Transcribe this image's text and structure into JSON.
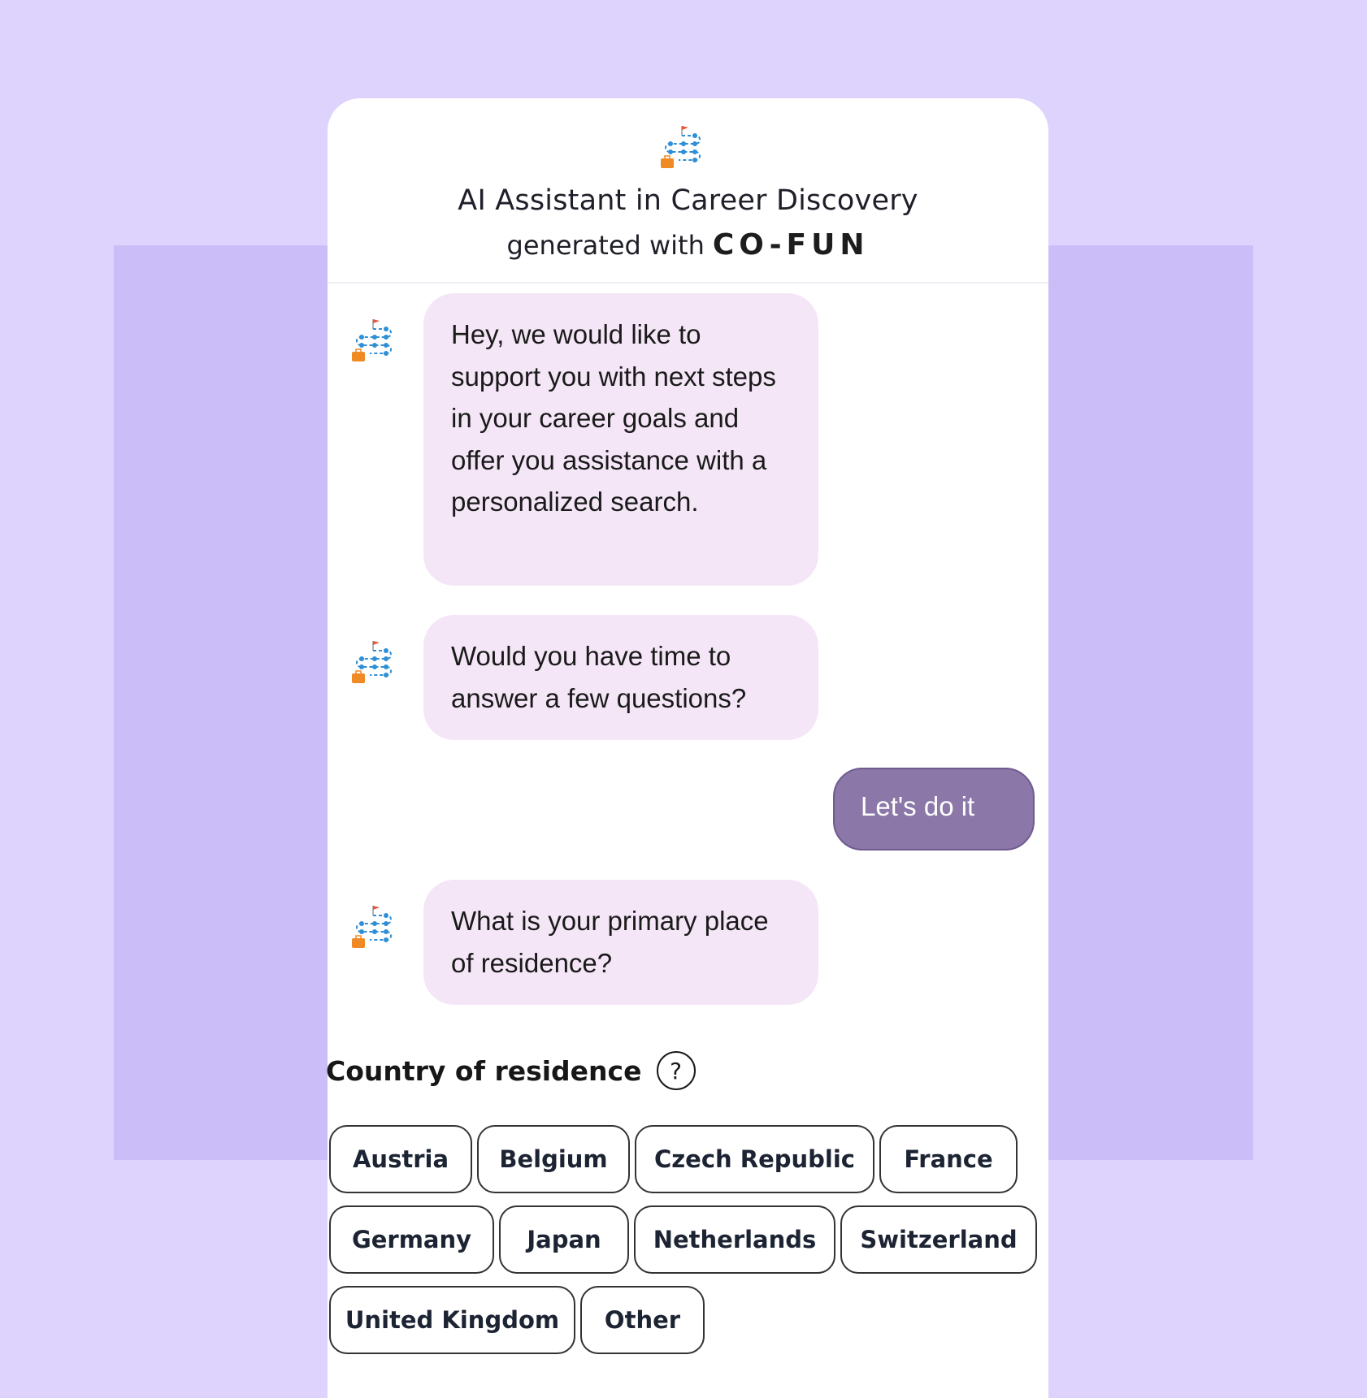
{
  "header": {
    "title": "AI Assistant in Career Discovery",
    "generated_prefix": "generated with",
    "brand": "CO-FUN",
    "logo_icon": "career-path-icon"
  },
  "messages": [
    {
      "role": "assistant",
      "text": "Hey, we would like to support you with next steps in your career goals and offer you assistance with a personalized search."
    },
    {
      "role": "assistant",
      "text": "Would you have time to answer a few questions?"
    },
    {
      "role": "user",
      "text": "Let's do it"
    },
    {
      "role": "assistant",
      "text": "What is your primary place of residence?"
    }
  ],
  "question": {
    "label": "Country of residence",
    "help_symbol": "?",
    "options": [
      "Austria",
      "Belgium",
      "Czech Republic",
      "France",
      "Germany",
      "Japan",
      "Netherlands",
      "Switzerland",
      "United Kingdom",
      "Other"
    ]
  },
  "colors": {
    "background": "#ddd3fd",
    "band": "#cbbdf7",
    "assistant_bubble": "#f4e6f7",
    "user_bubble": "#8b77a8",
    "icon_blue": "#2f8fd6",
    "icon_orange": "#f08a24",
    "icon_red": "#e8553a"
  }
}
